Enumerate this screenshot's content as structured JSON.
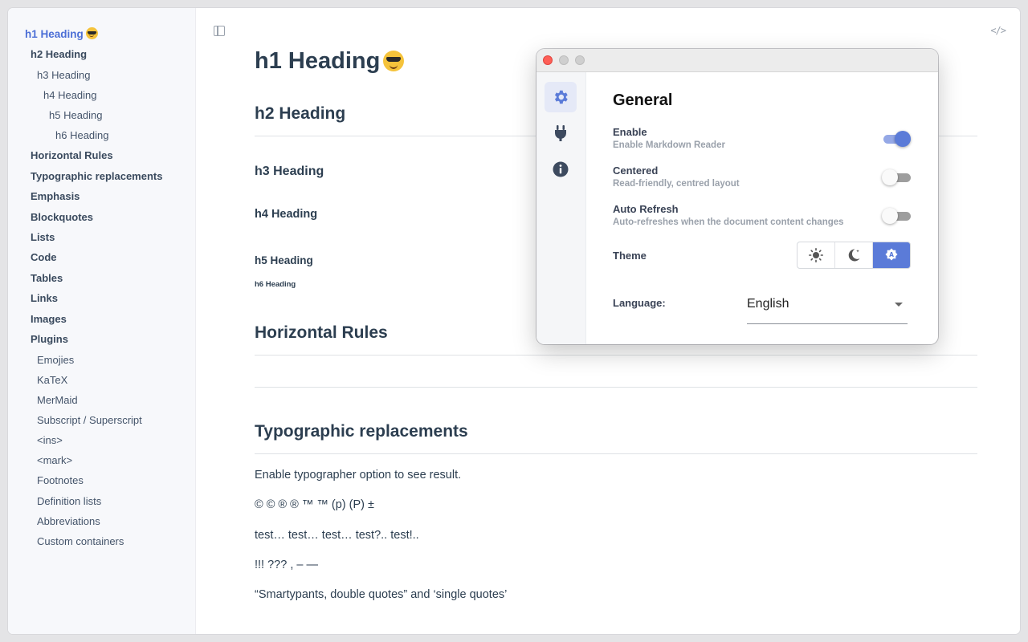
{
  "sidebar": {
    "items": [
      {
        "label": "h1 Heading",
        "emoji": "sunglasses-emoji",
        "level": "l1"
      },
      {
        "label": "h2 Heading",
        "level": "l2"
      },
      {
        "label": "h3 Heading",
        "level": "l3"
      },
      {
        "label": "h4 Heading",
        "level": "l4"
      },
      {
        "label": "h5 Heading",
        "level": "l5"
      },
      {
        "label": "h6 Heading",
        "level": "l6"
      },
      {
        "label": "Horizontal Rules",
        "level": "l2"
      },
      {
        "label": "Typographic replacements",
        "level": "l2"
      },
      {
        "label": "Emphasis",
        "level": "l2"
      },
      {
        "label": "Blockquotes",
        "level": "l2"
      },
      {
        "label": "Lists",
        "level": "l2"
      },
      {
        "label": "Code",
        "level": "l2"
      },
      {
        "label": "Tables",
        "level": "l2"
      },
      {
        "label": "Links",
        "level": "l2"
      },
      {
        "label": "Images",
        "level": "l2"
      },
      {
        "label": "Plugins",
        "level": "l2"
      },
      {
        "label": "Emojies",
        "level": "sub"
      },
      {
        "label": "KaTeX",
        "level": "sub"
      },
      {
        "label": "MerMaid",
        "level": "sub"
      },
      {
        "label": "Subscript / Superscript",
        "level": "sub"
      },
      {
        "label": "<ins>",
        "level": "sub"
      },
      {
        "label": "<mark>",
        "level": "sub"
      },
      {
        "label": "Footnotes",
        "level": "sub"
      },
      {
        "label": "Definition lists",
        "level": "sub"
      },
      {
        "label": "Abbreviations",
        "level": "sub"
      },
      {
        "label": "Custom containers",
        "level": "sub"
      }
    ]
  },
  "toolbar": {
    "sidebar_toggle_icon": "sidebar-toggle-icon",
    "code_toggle_label": "</>"
  },
  "document": {
    "h1": "h1 Heading",
    "h2": "h2 Heading",
    "h3": "h3 Heading",
    "h4": "h4 Heading",
    "h5": "h5 Heading",
    "h6": "h6 Heading",
    "hr_heading": "Horizontal Rules",
    "typo_heading": "Typographic replacements",
    "paragraphs": [
      "Enable typographer option to see result.",
      "© © ® ® ™ ™ (p) (P) ±",
      "test… test… test… test?.. test!..",
      "!!! ??? , – —",
      "“Smartypants, double quotes” and ‘single quotes’"
    ]
  },
  "settings": {
    "title": "General",
    "nav": [
      {
        "icon": "gear-icon",
        "active": true
      },
      {
        "icon": "plug-icon",
        "active": false
      },
      {
        "icon": "info-icon",
        "active": false
      }
    ],
    "options": [
      {
        "label": "Enable",
        "description": "Enable Markdown Reader",
        "on": true
      },
      {
        "label": "Centered",
        "description": "Read-friendly, centred layout",
        "on": false
      },
      {
        "label": "Auto Refresh",
        "description": "Auto-refreshes when the document content changes",
        "on": false
      }
    ],
    "theme": {
      "label": "Theme",
      "options": [
        "sun-icon",
        "moon-icon",
        "auto-theme-icon"
      ],
      "selected": "auto-theme-icon"
    },
    "language": {
      "label": "Language:",
      "value": "English"
    }
  },
  "colors": {
    "accent": "#5b7bd8",
    "close_button": "#fe5f57",
    "heading_text": "#2c3e50"
  }
}
